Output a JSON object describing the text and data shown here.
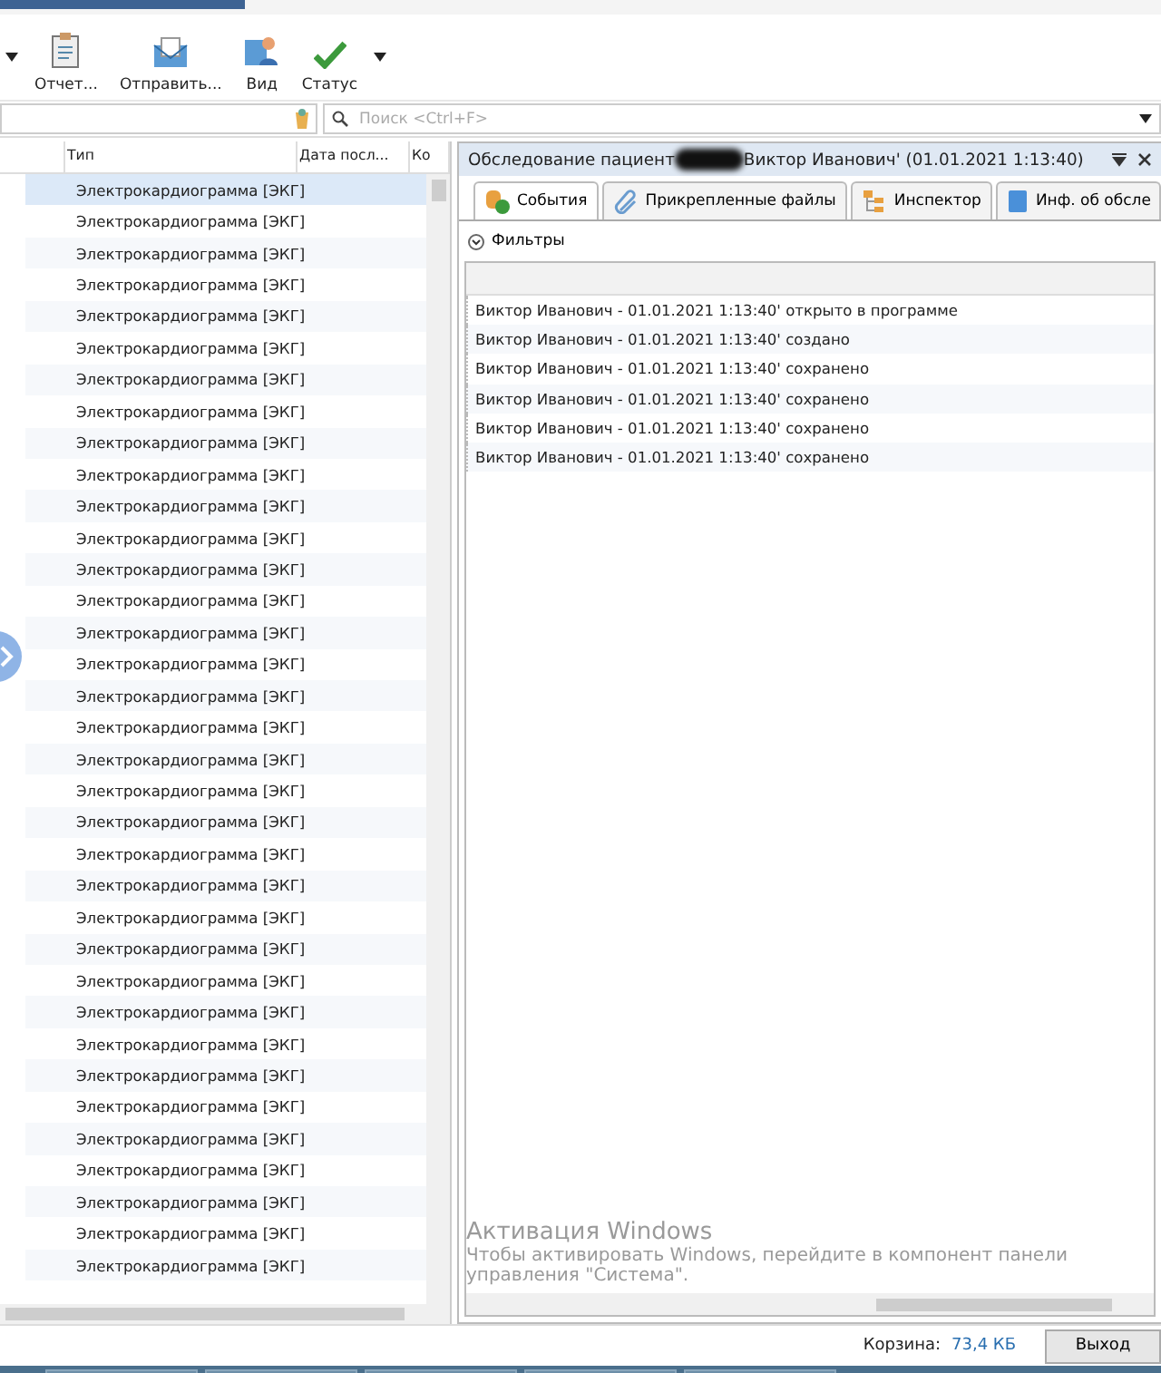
{
  "toolbar": {
    "buttons": [
      {
        "label": "Отчет...",
        "kind": "report"
      },
      {
        "label": "Отправить...",
        "kind": "send"
      },
      {
        "label": "Вид",
        "kind": "view"
      },
      {
        "label": "Статус",
        "kind": "status"
      }
    ]
  },
  "search": {
    "placeholder": "Поиск <Ctrl+F>"
  },
  "table": {
    "columns": [
      "Тип",
      "Дата посл...",
      "Ко"
    ],
    "rows": [
      {
        "type": "Электрокардиограмма [ЭКГ]",
        "selected": true
      },
      {
        "type": "Электрокардиограмма [ЭКГ]",
        "selected": false
      },
      {
        "type": "Электрокардиограмма [ЭКГ]",
        "selected": false
      },
      {
        "type": "Электрокардиограмма [ЭКГ]",
        "selected": false
      },
      {
        "type": "Электрокардиограмма [ЭКГ]",
        "selected": false
      },
      {
        "type": "Электрокардиограмма [ЭКГ]",
        "selected": false
      },
      {
        "type": "Электрокардиограмма [ЭКГ]",
        "selected": false
      },
      {
        "type": "Электрокардиограмма [ЭКГ]",
        "selected": false
      },
      {
        "type": "Электрокардиограмма [ЭКГ]",
        "selected": false
      },
      {
        "type": "Электрокардиограмма [ЭКГ]",
        "selected": false
      },
      {
        "type": "Электрокардиограмма [ЭКГ]",
        "selected": false
      },
      {
        "type": "Электрокардиограмма [ЭКГ]",
        "selected": false
      },
      {
        "type": "Электрокардиограмма [ЭКГ]",
        "selected": false
      },
      {
        "type": "Электрокардиограмма [ЭКГ]",
        "selected": false
      },
      {
        "type": "Электрокардиограмма [ЭКГ]",
        "selected": false
      },
      {
        "type": "Электрокардиограмма [ЭКГ]",
        "selected": false
      },
      {
        "type": "Электрокардиограмма [ЭКГ]",
        "selected": false
      },
      {
        "type": "Электрокардиограмма [ЭКГ]",
        "selected": false
      },
      {
        "type": "Электрокардиограмма [ЭКГ]",
        "selected": false
      },
      {
        "type": "Электрокардиограмма [ЭКГ]",
        "selected": false
      },
      {
        "type": "Электрокардиограмма [ЭКГ]",
        "selected": false
      },
      {
        "type": "Электрокардиограмма [ЭКГ]",
        "selected": false
      },
      {
        "type": "Электрокардиограмма [ЭКГ]",
        "selected": false
      },
      {
        "type": "Электрокардиограмма [ЭКГ]",
        "selected": false
      },
      {
        "type": "Электрокардиограмма [ЭКГ]",
        "selected": false
      },
      {
        "type": "Электрокардиограмма [ЭКГ]",
        "selected": false
      },
      {
        "type": "Электрокардиограмма [ЭКГ]",
        "selected": false
      },
      {
        "type": "Электрокардиограмма [ЭКГ]",
        "selected": false
      },
      {
        "type": "Электрокардиограмма [ЭКГ]",
        "selected": false
      },
      {
        "type": "Электрокардиограмма [ЭКГ]",
        "selected": false
      },
      {
        "type": "Электрокардиограмма [ЭКГ]",
        "selected": false
      },
      {
        "type": "Электрокардиограмма [ЭКГ]",
        "selected": false
      },
      {
        "type": "Электрокардиограмма [ЭКГ]",
        "selected": false
      },
      {
        "type": "Электрокардиограмма [ЭКГ]",
        "selected": false
      },
      {
        "type": "Электрокардиограмма [ЭКГ]",
        "selected": false
      }
    ]
  },
  "panel": {
    "title_start": "Обследование пациент",
    "title_end": "Виктор Иванович' (01.01.2021 1:13:40)",
    "tabs": [
      {
        "label": "События",
        "kind": "events",
        "selected": true
      },
      {
        "label": "Прикрепленные файлы",
        "kind": "files",
        "selected": false
      },
      {
        "label": "Инспектор",
        "kind": "inspector",
        "selected": false
      },
      {
        "label": "Инф. об обсле",
        "kind": "info",
        "selected": false
      }
    ],
    "filters": "Фильтры",
    "events": [
      "Виктор Иванович - 01.01.2021 1:13:40' открыто в программе",
      "Виктор Иванович - 01.01.2021 1:13:40' создано",
      "Виктор Иванович - 01.01.2021 1:13:40' сохранено",
      "Виктор Иванович - 01.01.2021 1:13:40' сохранено",
      "Виктор Иванович - 01.01.2021 1:13:40' сохранено",
      "Виктор Иванович - 01.01.2021 1:13:40' сохранено"
    ]
  },
  "activation": {
    "title": "Активация Windows",
    "line1": "Чтобы активировать Windows, перейдите в компонент панели",
    "line2": "управления \"Система\"."
  },
  "status_bar": {
    "basket_label": "Корзина:",
    "basket_size": "73,4 КБ",
    "exit": "Выход"
  }
}
